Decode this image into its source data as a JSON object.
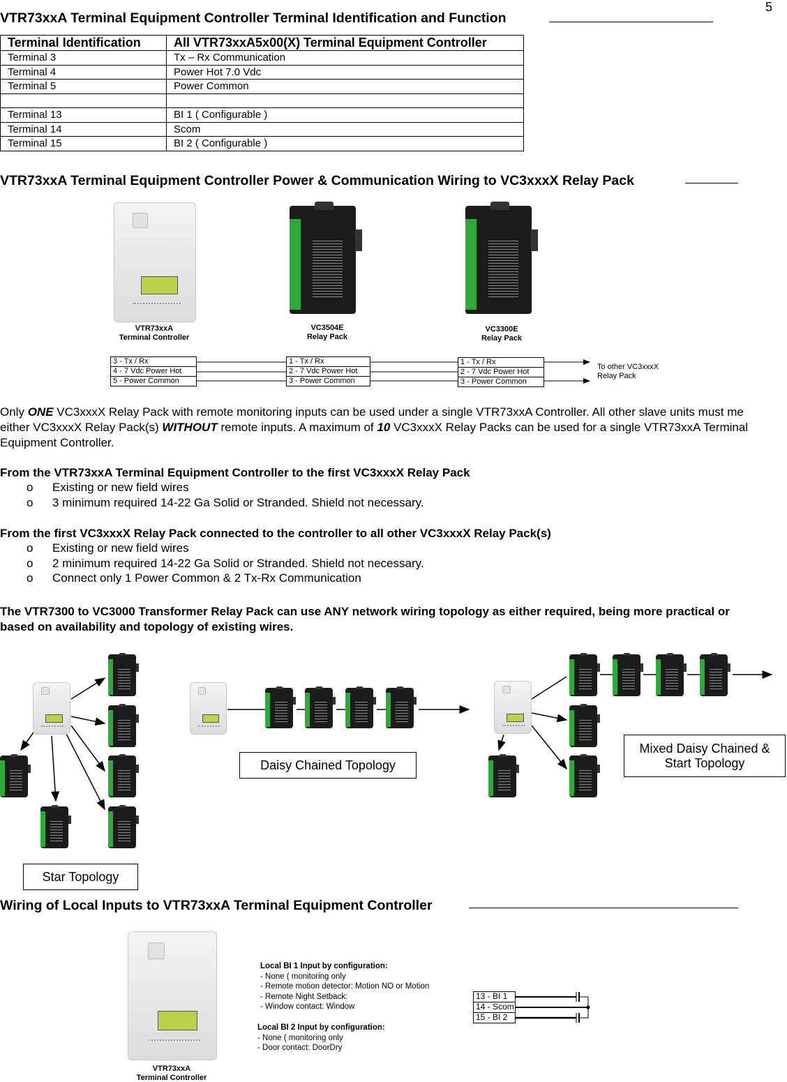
{
  "page_number": "5",
  "section1": {
    "title": "VTR73xxA Terminal Equipment Controller Terminal Identification and Function",
    "table": {
      "headers": [
        "Terminal Identification",
        "All VTR73xxA5x00(X) Terminal Equipment Controller"
      ],
      "rows": [
        [
          "Terminal 3",
          "Tx – Rx Communication"
        ],
        [
          "Terminal 4",
          "Power Hot 7.0 Vdc"
        ],
        [
          "Terminal 5",
          "Power Common"
        ],
        [
          "",
          ""
        ],
        [
          "Terminal 13",
          "BI 1 ( Configurable )"
        ],
        [
          "Terminal 14",
          "Scom"
        ],
        [
          "Terminal 15",
          "BI 2  ( Configurable )"
        ]
      ]
    }
  },
  "section2": {
    "title": "VTR73xxA Terminal Equipment Controller Power & Communication Wiring to VC3xxxX Relay Pack",
    "devices": [
      {
        "name": "VTR73xxA",
        "sub": "Terminal Controller",
        "terminals": [
          "3 - Tx / Rx",
          "4 - 7 Vdc Power Hot",
          "5 - Power Common"
        ]
      },
      {
        "name": "VC3504E",
        "sub": "Relay Pack",
        "terminals": [
          "1 - Tx / Rx",
          "2 - 7 Vdc Power Hot",
          "3 - Power Common"
        ]
      },
      {
        "name": "VC3300E",
        "sub": "Relay Pack",
        "terminals": [
          "1 - Tx / Rx",
          "2 - 7 Vdc Power Hot",
          "3 - Power Common"
        ]
      }
    ],
    "to_other": "To other VC3xxxX",
    "to_other2": "Relay Pack",
    "para": {
      "a": "Only ",
      "b": "ONE",
      "c": " VC3xxxX Relay Pack with remote monitoring inputs can be used under a single VTR73xxA Controller. All other slave units must me either VC3xxxX  Relay Pack(s) ",
      "d": "WITHOUT",
      "e": " remote inputs. A maximum of ",
      "f": "10",
      "g": " VC3xxxX Relay Packs can be used for a single VTR73xxA Terminal Equipment Controller."
    },
    "list1": {
      "heading": "From the VTR73xxA Terminal Equipment Controller to the first VC3xxxX Relay Pack",
      "items": [
        "Existing or new field wires",
        "3 minimum required 14-22 Ga Solid or Stranded. Shield not necessary."
      ]
    },
    "list2": {
      "heading": "From the first VC3xxxX Relay Pack connected to the controller to all other VC3xxxX Relay Pack(s)",
      "items": [
        "Existing or new field wires",
        "2 minimum required 14-22 Ga Solid or Stranded. Shield not necessary.",
        "Connect only 1 Power Common & 2 Tx-Rx Communication"
      ]
    },
    "bullet": "o",
    "topology_note": "The VTR7300 to VC3000 Transformer Relay Pack can use ANY network wiring topology as either required, being more practical or based on availability and topology of existing wires.",
    "topologies": {
      "star": "Star Topology",
      "daisy": "Daisy Chained Topology",
      "mixed": "Mixed Daisy Chained & Start Topology"
    }
  },
  "section3": {
    "title": "Wiring of Local Inputs to VTR73xxA Terminal Equipment Controller",
    "controller": {
      "name": "VTR73xxA",
      "sub": "Terminal Controller"
    },
    "bi1": {
      "heading": "Local BI 1 Input by configuration:",
      "items": [
        "- None ( monitoring only",
        "- Remote motion detector: Motion NO or Motion",
        "- Remote Night Setback:",
        "- Window contact: Window"
      ]
    },
    "bi2": {
      "heading": "Local BI 2 Input by configuration:",
      "items": [
        "- None ( monitoring only",
        "- Door contact: DoorDry"
      ]
    },
    "terminals": [
      "13 - BI 1",
      "14 - Scom",
      "15 - BI 2"
    ]
  },
  "colors": {
    "lcd": "#b8d34a",
    "relay_stripe": "#2faa3a",
    "relay_body": "#1c1c1c"
  }
}
